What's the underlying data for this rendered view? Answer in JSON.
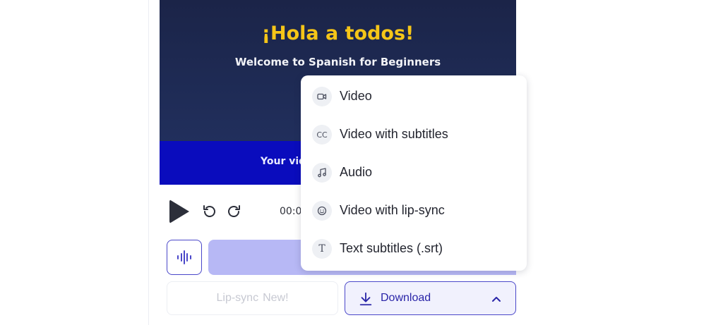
{
  "video": {
    "title": "¡Hola a todos!",
    "subtitle": "Welcome to Spanish for Beginners",
    "caption": "Your vide"
  },
  "player": {
    "time": "00:0"
  },
  "actions": {
    "lipsync_label": "Lip-sync",
    "lipsync_badge": "New!",
    "download_label": "Download"
  },
  "download_menu": {
    "items": [
      {
        "label": "Video",
        "icon": "video-camera-icon"
      },
      {
        "label": "Video with subtitles",
        "icon": "closed-captions-icon",
        "icon_text": "CC"
      },
      {
        "label": "Audio",
        "icon": "music-note-icon"
      },
      {
        "label": "Video with lip-sync",
        "icon": "smiley-face-icon"
      },
      {
        "label": "Text subtitles (.srt)",
        "icon": "text-t-icon",
        "icon_text": "T"
      }
    ]
  },
  "colors": {
    "accent": "#4a47c9",
    "title_yellow": "#f5c518",
    "caption_band": "#0a0cbd",
    "video_bg": "#1f2c57"
  }
}
